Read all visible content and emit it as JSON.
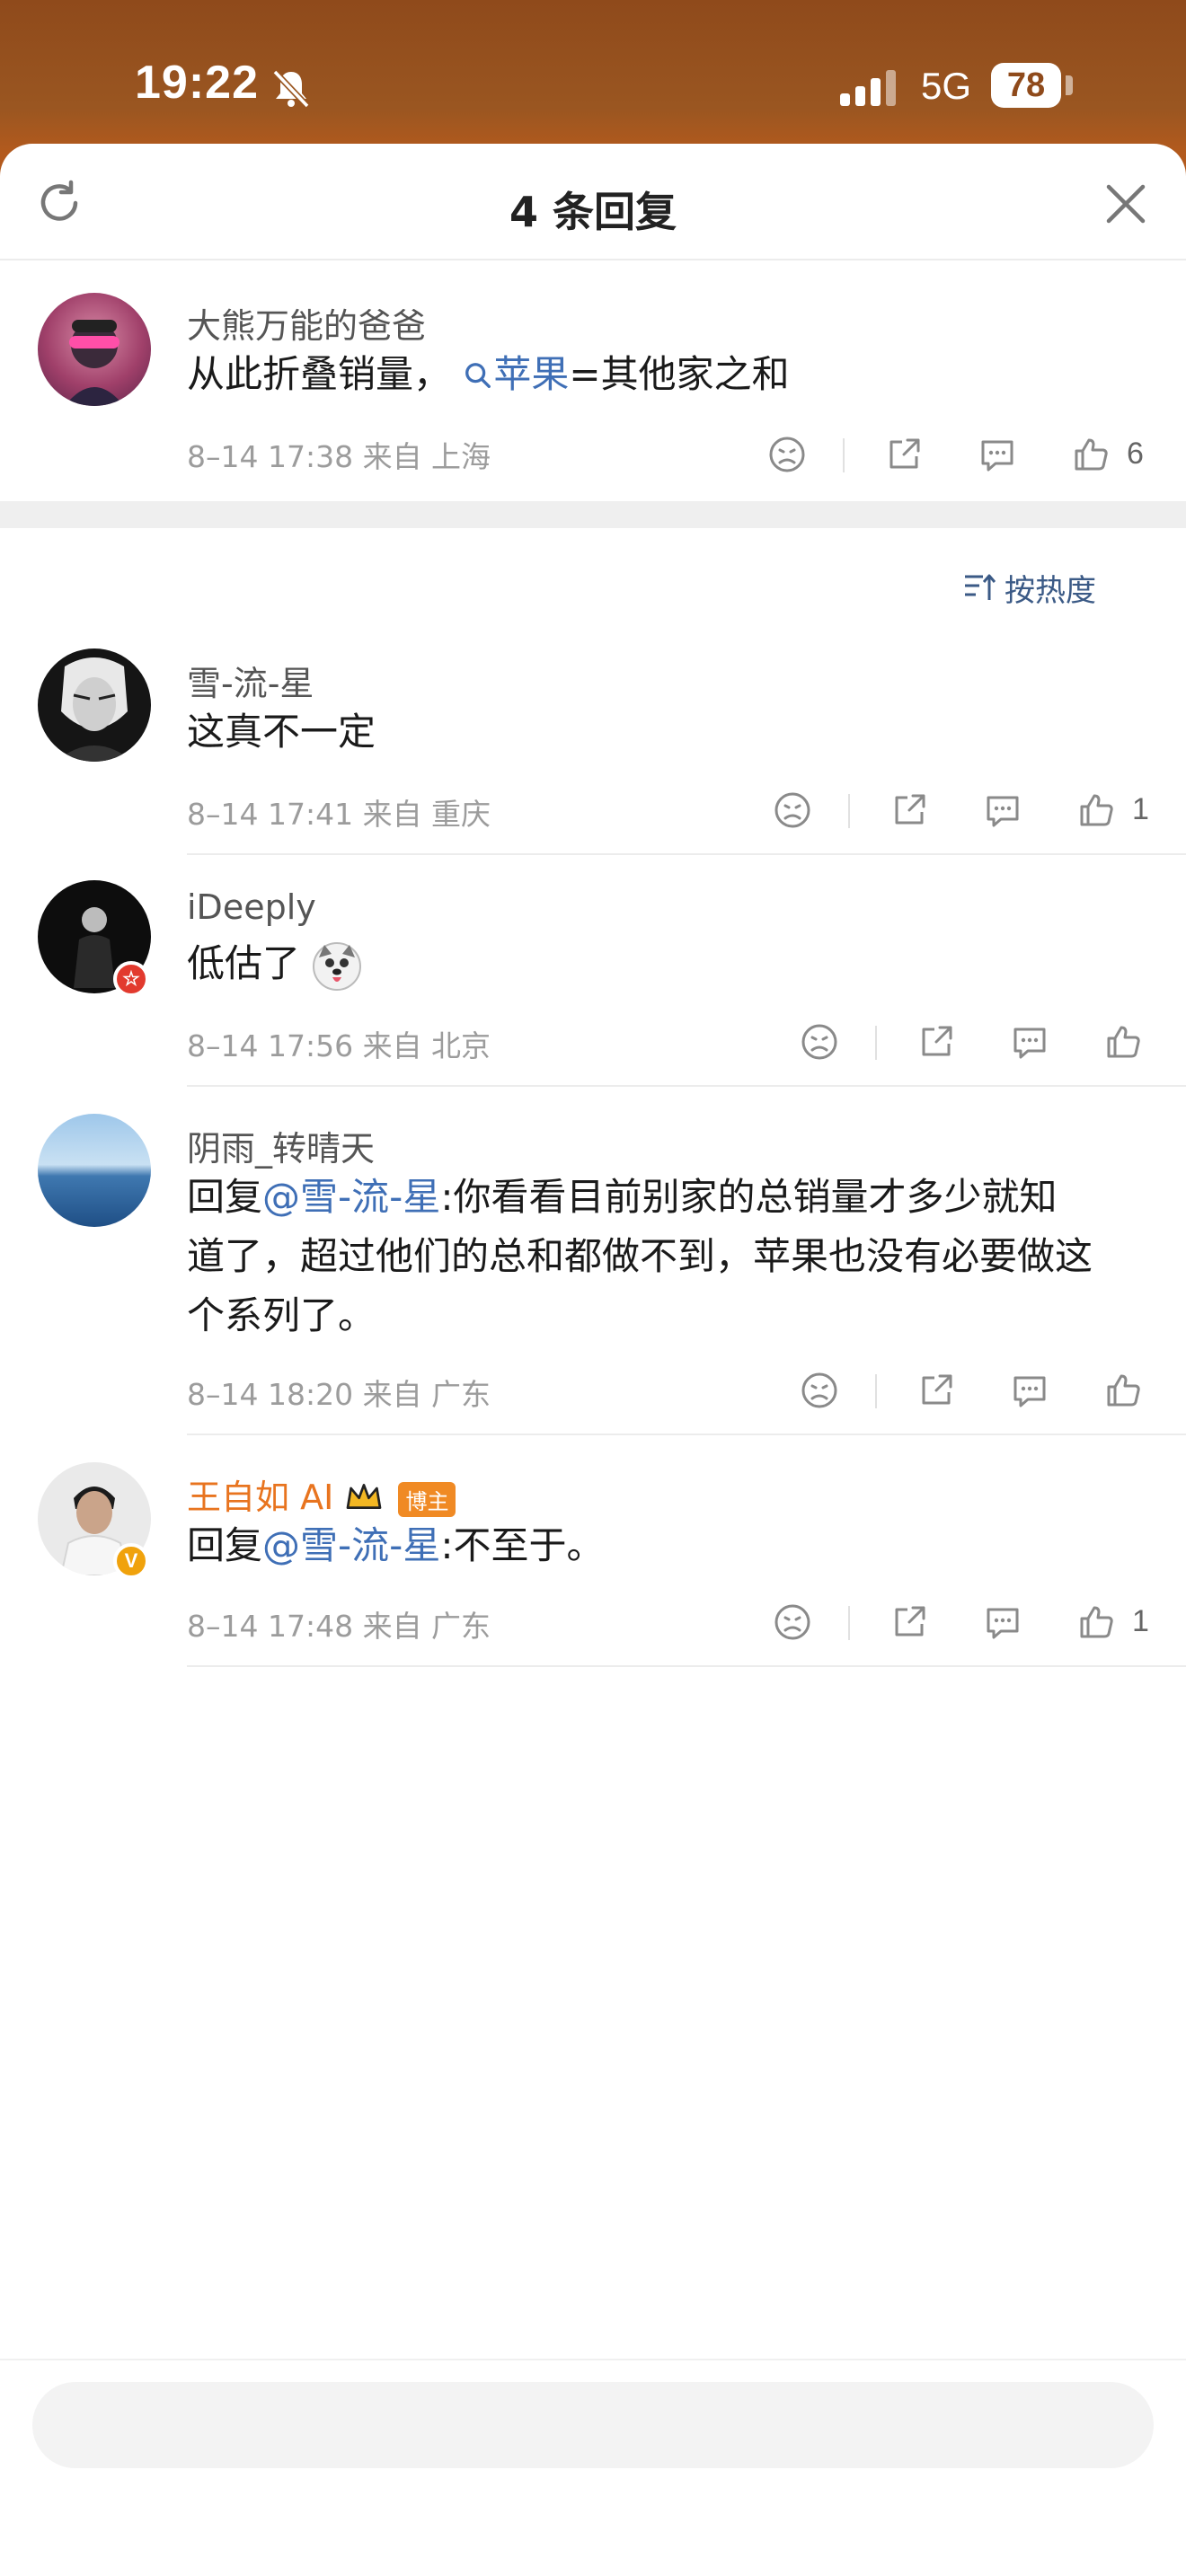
{
  "status_bar": {
    "time": "19:22",
    "network": "5G",
    "battery": "78"
  },
  "header": {
    "title": "4 条回复"
  },
  "root_comment": {
    "username": "大熊万能的爸爸",
    "text_before": "从此折叠销量，",
    "topic": "苹果",
    "text_after": "=其他家之和",
    "meta": "8–14 17:38  来自 上海",
    "likes": "6"
  },
  "sort": {
    "label": "按热度"
  },
  "replies": [
    {
      "username": "雪-流-星",
      "text": "这真不一定",
      "meta": "8–14 17:41  来自 重庆",
      "likes": "1"
    },
    {
      "username": "iDeeply",
      "text": "低估了",
      "meta": "8–14 17:56  来自 北京",
      "likes": ""
    },
    {
      "username": "阴雨_转晴天",
      "prefix": "回复",
      "mention": "@雪-流-星",
      "text_line1": ":你看看目前别家的总销量才多少就知",
      "text_line2": "道了，超过他们的总和都做不到，苹果也没有必要做这",
      "text_line3": "个系列了。",
      "meta": "8–14 18:20  来自 广东",
      "likes": ""
    },
    {
      "username": "王自如 AI",
      "badge": "博主",
      "prefix": "回复",
      "mention": "@雪-流-星",
      "text": ":不至于。",
      "meta": "8–14 17:48  来自 广东",
      "likes": "1"
    }
  ],
  "colors": {
    "accent_link": "#3f6fb6",
    "author_name": "#e8741f",
    "status_bg": "#8f4a1b"
  }
}
